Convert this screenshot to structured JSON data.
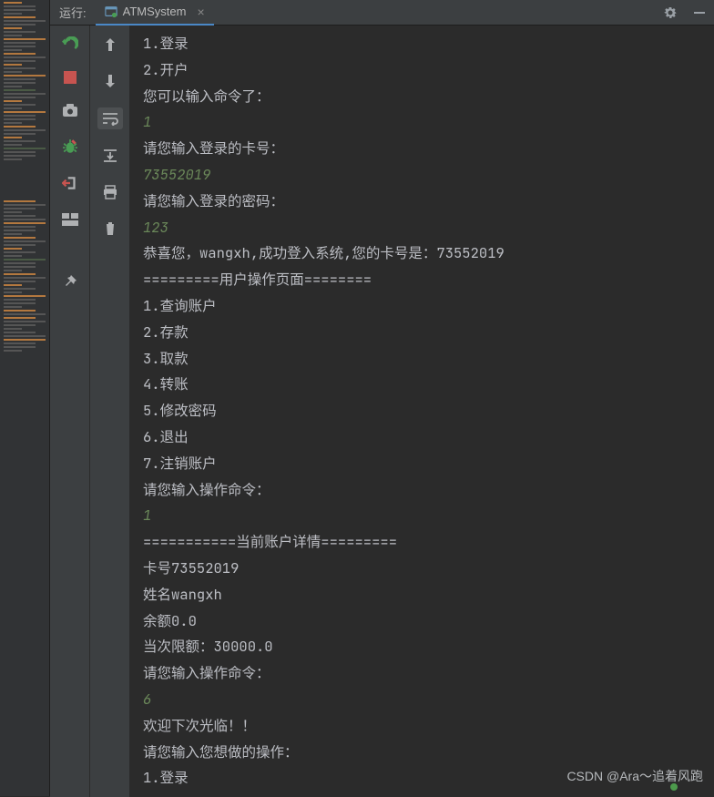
{
  "header": {
    "run_label": "运行:",
    "tab_title": "ATMSystem"
  },
  "icons": {
    "settings": "settings-icon",
    "minimize": "minimize-icon",
    "rerun": "rerun-icon",
    "stop": "stop-icon",
    "camera": "camera-icon",
    "bug": "debug-icon",
    "exit": "exit-icon",
    "layout": "layout-icon",
    "pin": "pin-icon",
    "up": "up-arrow-icon",
    "down": "down-arrow-icon",
    "wrap": "soft-wrap-icon",
    "scroll": "scroll-to-end-icon",
    "print": "print-icon",
    "trash": "trash-icon"
  },
  "console_lines": [
    {
      "t": "out",
      "v": "1.登录"
    },
    {
      "t": "out",
      "v": "2.开户"
    },
    {
      "t": "out",
      "v": "您可以输入命令了："
    },
    {
      "t": "in",
      "v": "1"
    },
    {
      "t": "out",
      "v": "请您输入登录的卡号："
    },
    {
      "t": "in",
      "v": "73552019"
    },
    {
      "t": "out",
      "v": "请您输入登录的密码："
    },
    {
      "t": "in",
      "v": "123"
    },
    {
      "t": "out",
      "v": "恭喜您，wangxh,成功登入系统,您的卡号是：73552019"
    },
    {
      "t": "out",
      "v": "=========用户操作页面========"
    },
    {
      "t": "out",
      "v": "1.查询账户"
    },
    {
      "t": "out",
      "v": "2.存款"
    },
    {
      "t": "out",
      "v": "3.取款"
    },
    {
      "t": "out",
      "v": "4.转账"
    },
    {
      "t": "out",
      "v": "5.修改密码"
    },
    {
      "t": "out",
      "v": "6.退出"
    },
    {
      "t": "out",
      "v": "7.注销账户"
    },
    {
      "t": "out",
      "v": "请您输入操作命令："
    },
    {
      "t": "in",
      "v": "1"
    },
    {
      "t": "out",
      "v": "===========当前账户详情========="
    },
    {
      "t": "out",
      "v": "卡号73552019"
    },
    {
      "t": "out",
      "v": "姓名wangxh"
    },
    {
      "t": "out",
      "v": "余额0.0"
    },
    {
      "t": "out",
      "v": "当次限额：30000.0"
    },
    {
      "t": "out",
      "v": "请您输入操作命令："
    },
    {
      "t": "in",
      "v": "6"
    },
    {
      "t": "out",
      "v": "欢迎下次光临！！"
    },
    {
      "t": "out",
      "v": "请您输入您想做的操作："
    },
    {
      "t": "out",
      "v": "1.登录"
    }
  ],
  "watermark": "CSDN @Ara～追着风跑"
}
